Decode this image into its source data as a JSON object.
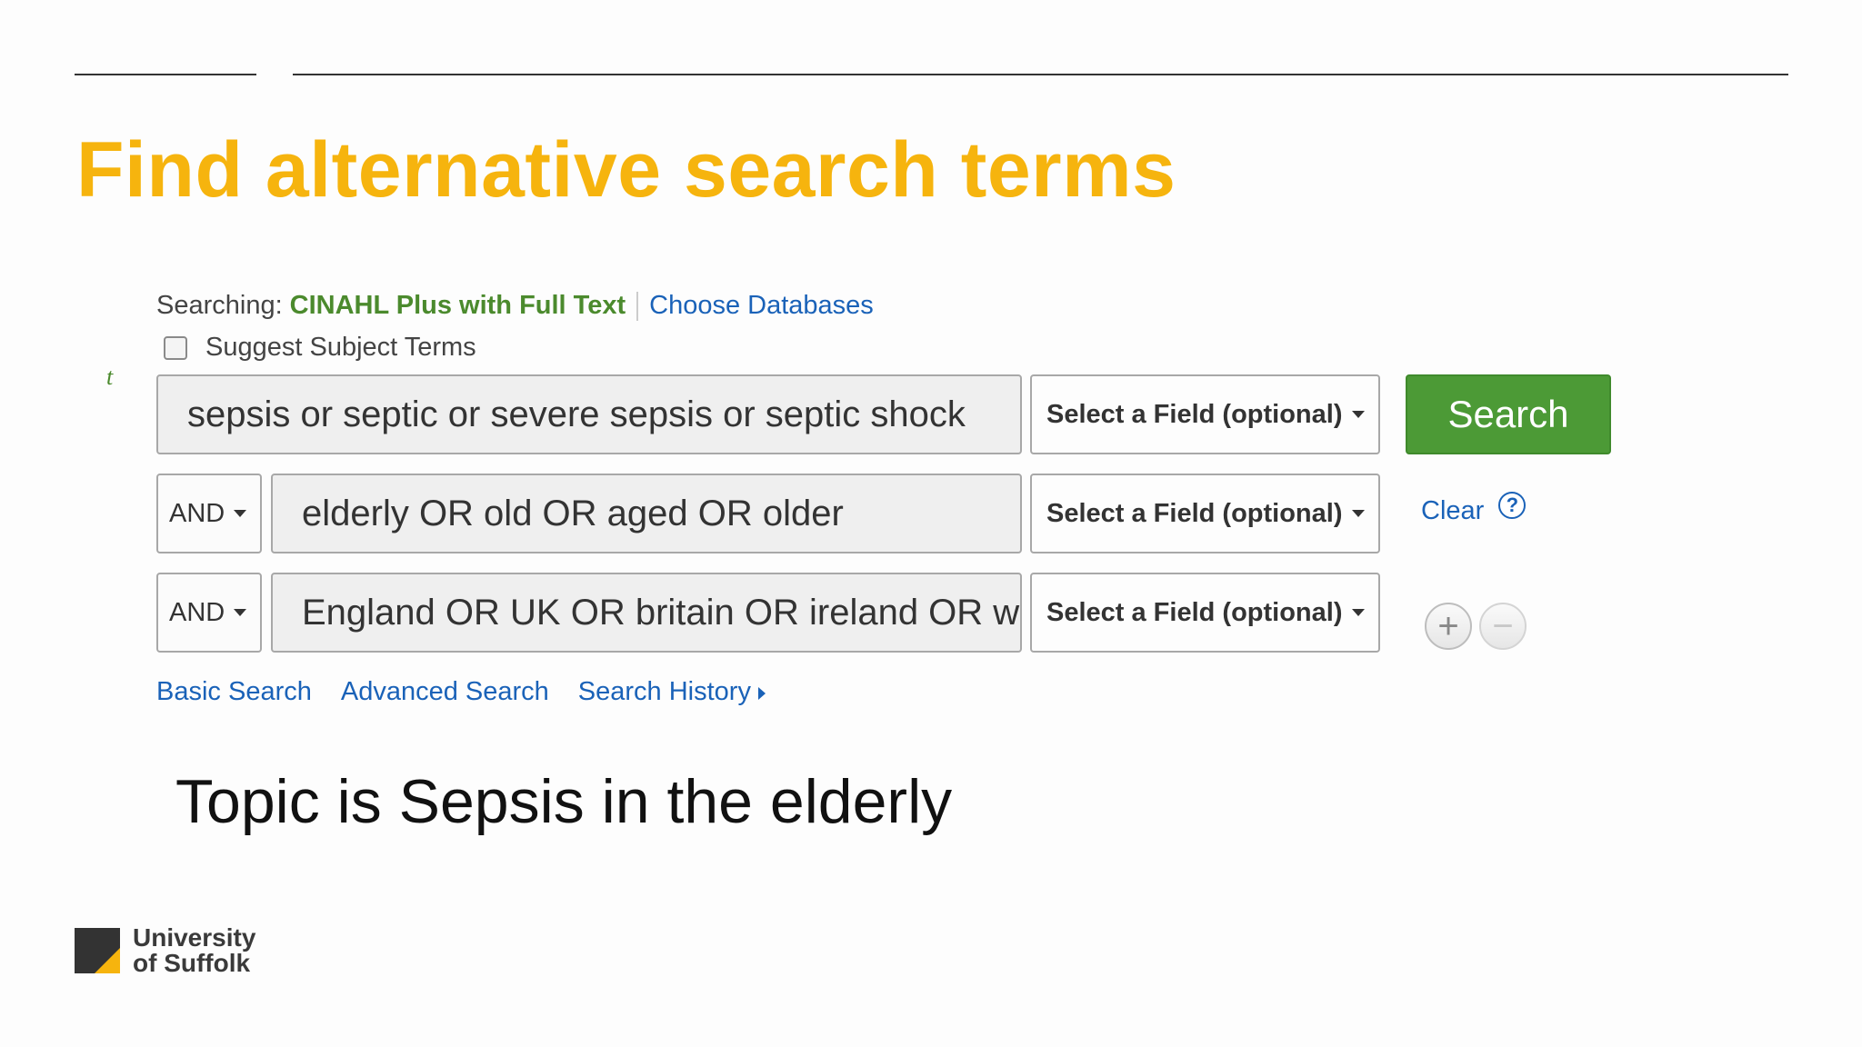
{
  "slide": {
    "title": "Find alternative search terms",
    "caption": "Topic is Sepsis in the elderly"
  },
  "header": {
    "searching_label": "Searching:",
    "database": "CINAHL Plus with Full Text",
    "choose_databases": "Choose Databases"
  },
  "suggest": {
    "label": "Suggest Subject Terms",
    "checked": false
  },
  "stray_glyph": "t",
  "rows": [
    {
      "term": "sepsis or septic or severe sepsis or septic shock",
      "field": "Select a Field (optional)"
    },
    {
      "operator": "AND",
      "term": "elderly OR old OR aged OR older",
      "field": "Select a Field (optional)"
    },
    {
      "operator": "AND",
      "term": "England OR UK OR britain OR ireland OR wales",
      "field": "Select a Field (optional)"
    }
  ],
  "actions": {
    "search": "Search",
    "clear": "Clear",
    "help": "?",
    "add": "+",
    "remove": "−"
  },
  "links": {
    "basic": "Basic Search",
    "advanced": "Advanced Search",
    "history": "Search History"
  },
  "logo": {
    "line1": "University",
    "line2": "of Suffolk",
    "colors": {
      "dark": "#333333",
      "accent": "#f6b40e"
    }
  },
  "colors": {
    "title": "#f6b40e",
    "search_button": "#4c9a36",
    "link": "#1a62b8",
    "database": "#4b8a2d"
  }
}
